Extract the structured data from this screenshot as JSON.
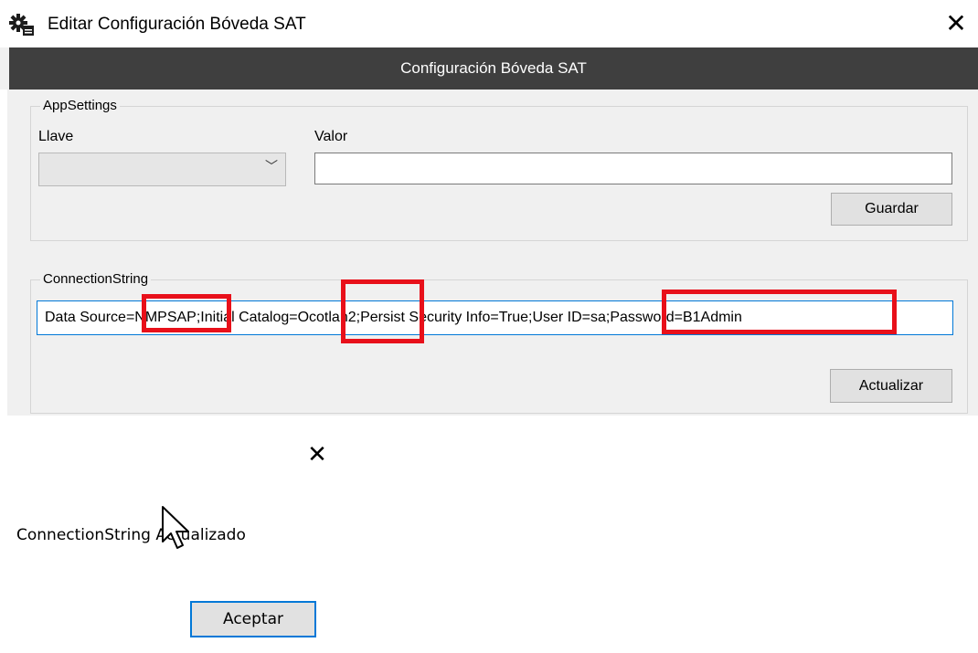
{
  "window": {
    "title": "Editar Configuración Bóveda SAT",
    "close_glyph": "✕",
    "icon": "gear-icon"
  },
  "header": {
    "title": "Configuración Bóveda SAT"
  },
  "appsettings": {
    "legend": "AppSettings",
    "key_label": "Llave",
    "key_value": "",
    "value_label": "Valor",
    "value_text": "",
    "save_label": "Guardar",
    "chevron": "﹀"
  },
  "connection": {
    "legend": "ConnectionString",
    "value": "Data Source=NMPSAP;Initial Catalog=Ocotlan2;Persist Security Info=True;User ID=sa;Password=B1Admin",
    "update_label": "Actualizar",
    "highlight_color": "#e8101a"
  },
  "dialog": {
    "close_glyph": "✕",
    "message": "ConnectionString Actualizado",
    "ok_label": "Aceptar"
  }
}
